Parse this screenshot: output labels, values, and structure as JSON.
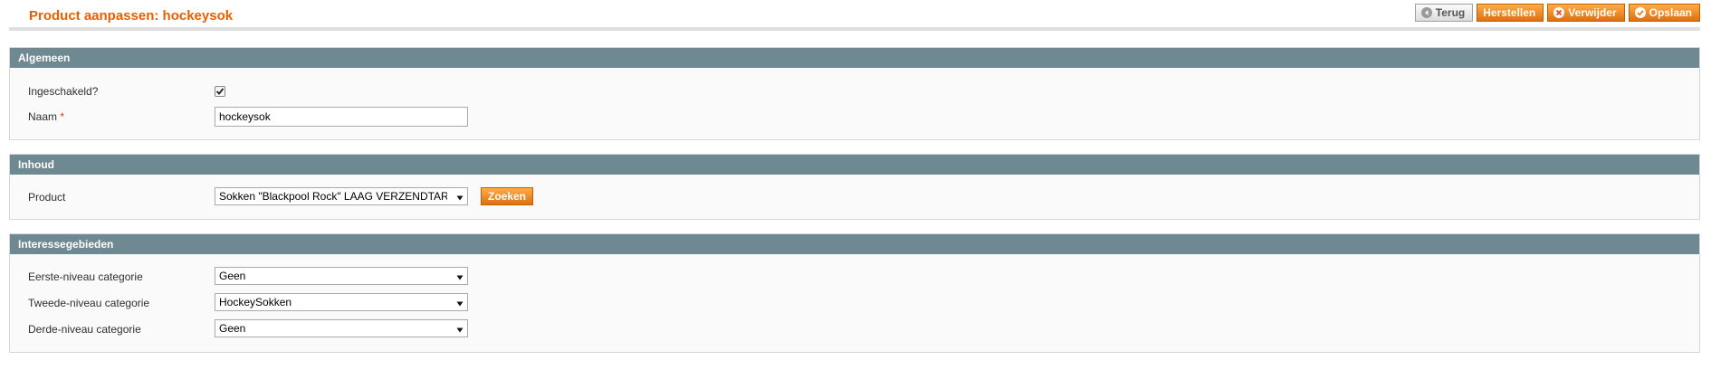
{
  "page": {
    "title": "Product aanpassen: hockeysok"
  },
  "actions": {
    "back_label": "Terug",
    "reset_label": "Herstellen",
    "delete_label": "Verwijder",
    "save_label": "Opslaan"
  },
  "icons": {
    "back": "back-arrow-icon",
    "delete": "cross-circle-icon",
    "save": "check-circle-icon",
    "dropdown": "triangle-down-icon"
  },
  "colors": {
    "accent": "#eb5e00",
    "section_header": "#6f8992",
    "required": "#eb340a"
  },
  "sections": {
    "general": {
      "title": "Algemeen",
      "enabled_label": "Ingeschakeld?",
      "enabled_checked": true,
      "name_label": "Naam",
      "name_required_mark": "*",
      "name_value": "hockeysok"
    },
    "content": {
      "title": "Inhoud",
      "product_label": "Product",
      "product_selected": "Sokken \"Blackpool Rock\" LAAG VERZENDTARIEF",
      "search_label": "Zoeken"
    },
    "interests": {
      "title": "Interessegebieden",
      "level1_label": "Eerste-niveau categorie",
      "level1_value": "Geen",
      "level2_label": "Tweede-niveau categorie",
      "level2_value": "HockeySokken",
      "level3_label": "Derde-niveau categorie",
      "level3_value": "Geen"
    }
  }
}
